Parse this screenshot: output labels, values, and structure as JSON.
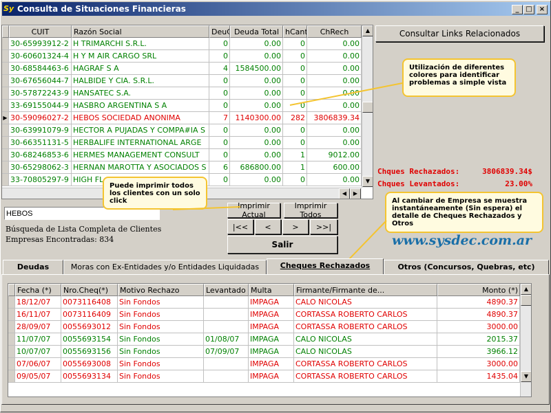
{
  "window": {
    "title": "Consulta de Situaciones Financieras",
    "app_icon": "Sy"
  },
  "title_buttons": {
    "minimize": "_",
    "maximize": "□",
    "close": "×"
  },
  "top_grid": {
    "columns": [
      "CUIT",
      "Razón Social",
      "DeuC",
      "Deuda Total",
      "hCant",
      "ChRech"
    ],
    "rows": [
      {
        "cuit": "30-65993912-2",
        "razon": "H TRIMARCHI S.R.L.",
        "deuc": "0",
        "total": "0.00",
        "hcant": "0",
        "chrech": "0.00",
        "color": "green"
      },
      {
        "cuit": "30-60601324-4",
        "razon": "H Y M AIR CARGO SRL",
        "deuc": "0",
        "total": "0.00",
        "hcant": "0",
        "chrech": "0.00",
        "color": "green"
      },
      {
        "cuit": "30-68584463-6",
        "razon": "HAGRAF S A",
        "deuc": "4",
        "total": "1584500.00",
        "hcant": "0",
        "chrech": "0.00",
        "color": "green"
      },
      {
        "cuit": "30-67656044-7",
        "razon": "HALBIDE Y CIA. S.R.L.",
        "deuc": "0",
        "total": "0.00",
        "hcant": "0",
        "chrech": "0.00",
        "color": "green"
      },
      {
        "cuit": "30-57872243-9",
        "razon": "HANSATEC S.A.",
        "deuc": "0",
        "total": "0.00",
        "hcant": "0",
        "chrech": "0.00",
        "color": "green"
      },
      {
        "cuit": "33-69155044-9",
        "razon": "HASBRO ARGENTINA S A",
        "deuc": "0",
        "total": "0.00",
        "hcant": "0",
        "chrech": "0.00",
        "color": "green"
      },
      {
        "cuit": "30-59096027-2",
        "razon": "HEBOS SOCIEDAD ANONIMA",
        "deuc": "7",
        "total": "1140300.00",
        "hcant": "282",
        "chrech": "3806839.34",
        "color": "red",
        "current": true
      },
      {
        "cuit": "30-63991079-9",
        "razon": "HECTOR A PUJADAS Y COMPA#IA S",
        "deuc": "0",
        "total": "0.00",
        "hcant": "0",
        "chrech": "0.00",
        "color": "green"
      },
      {
        "cuit": "30-66351131-5",
        "razon": "HERBALIFE INTERNATIONAL ARGE",
        "deuc": "0",
        "total": "0.00",
        "hcant": "0",
        "chrech": "0.00",
        "color": "green"
      },
      {
        "cuit": "30-68246853-6",
        "razon": "HERMES MANAGEMENT CONSULT",
        "deuc": "0",
        "total": "0.00",
        "hcant": "1",
        "chrech": "9012.00",
        "color": "green"
      },
      {
        "cuit": "30-65298062-3",
        "razon": "HERNAN MAROTTA Y ASOCIADOS S",
        "deuc": "6",
        "total": "686800.00",
        "hcant": "1",
        "chrech": "600.00",
        "color": "green"
      },
      {
        "cuit": "33-70805297-9",
        "razon": "HIGH FL",
        "deuc": "0",
        "total": "0.00",
        "hcant": "0",
        "chrech": "0.00",
        "color": "green"
      }
    ],
    "current_marker": "▶"
  },
  "links_button": "Consultar Links Relacionados",
  "callout_colors": "Utilización de diferentes colores para identificar problemas a simple vista",
  "callout_print": "Puede imprimir todos los clientes con un solo click",
  "callout_empresa": "Al cambiar de Empresa se muestra instantáneamente (Sin espera) el detalle de Cheques Rechazados y Otros",
  "totals": {
    "rechazados_label": "Chques Rechazados:",
    "rechazados_value": "3806839.34$",
    "levantados_label": "Chques Levantados:",
    "levantados_value": "23.00%"
  },
  "search": {
    "value": "HEBOS"
  },
  "info": {
    "line1": "Búsqueda de Lista Completa de Clientes",
    "line2": "Empresas Encontradas: 834"
  },
  "buttons": {
    "imprimir_actual": "Imprimir Actual",
    "imprimir_todos": "Imprimir Todos",
    "first": "|<<",
    "prev": "<",
    "next": ">",
    "last": ">>|",
    "salir": "Salir"
  },
  "website": "www.sysdec.com.ar",
  "tabs": [
    {
      "label": "Deudas"
    },
    {
      "label": "Moras con Ex-Entidades y/o Entidades Liquidadas"
    },
    {
      "label": "Cheques Rechazados"
    },
    {
      "label": "Otros (Concursos, Quebras, etc)"
    }
  ],
  "cheques_grid": {
    "columns": [
      "Fecha (*)",
      "Nro.Cheq(*)",
      "Motivo Rechazo",
      "Levantado",
      "Multa",
      "Firmante/Firmante de...",
      "Monto (*)"
    ],
    "rows": [
      {
        "fecha": "18/12/07",
        "nro": "0073116408",
        "motivo": "Sin Fondos",
        "levantado": "",
        "multa": "IMPAGA",
        "firmante": "CALO NICOLAS",
        "monto": "4890.37",
        "color": "red"
      },
      {
        "fecha": "16/11/07",
        "nro": "0073116409",
        "motivo": "Sin Fondos",
        "levantado": "",
        "multa": "IMPAGA",
        "firmante": "CORTASSA ROBERTO CARLOS",
        "monto": "4890.37",
        "color": "red"
      },
      {
        "fecha": "28/09/07",
        "nro": "0055693012",
        "motivo": "Sin Fondos",
        "levantado": "",
        "multa": "IMPAGA",
        "firmante": "CORTASSA ROBERTO CARLOS",
        "monto": "3000.00",
        "color": "red"
      },
      {
        "fecha": "11/07/07",
        "nro": "0055693154",
        "motivo": "Sin Fondos",
        "levantado": "01/08/07",
        "multa": "IMPAGA",
        "firmante": "CALO NICOLAS",
        "monto": "2015.37",
        "color": "green"
      },
      {
        "fecha": "10/07/07",
        "nro": "0055693156",
        "motivo": "Sin Fondos",
        "levantado": "07/09/07",
        "multa": "IMPAGA",
        "firmante": "CALO NICOLAS",
        "monto": "3966.12",
        "color": "green"
      },
      {
        "fecha": "07/06/07",
        "nro": "0055693008",
        "motivo": "Sin Fondos",
        "levantado": "",
        "multa": "IMPAGA",
        "firmante": "CORTASSA ROBERTO CARLOS",
        "monto": "3000.00",
        "color": "red"
      },
      {
        "fecha": "09/05/07",
        "nro": "0055693134",
        "motivo": "Sin Fondos",
        "levantado": "",
        "multa": "IMPAGA",
        "firmante": "CORTASSA ROBERTO CARLOS",
        "monto": "1435.04",
        "color": "red"
      }
    ]
  },
  "colors": {
    "red": "#e00000",
    "green": "#008000",
    "title_start": "#0a246a",
    "title_end": "#a6caf0",
    "callout_border": "#f4c430",
    "website": "#1a6fa8"
  },
  "icons": {
    "scroll_up": "▲",
    "scroll_down": "▼",
    "scroll_left": "◀",
    "scroll_right": "▶"
  }
}
